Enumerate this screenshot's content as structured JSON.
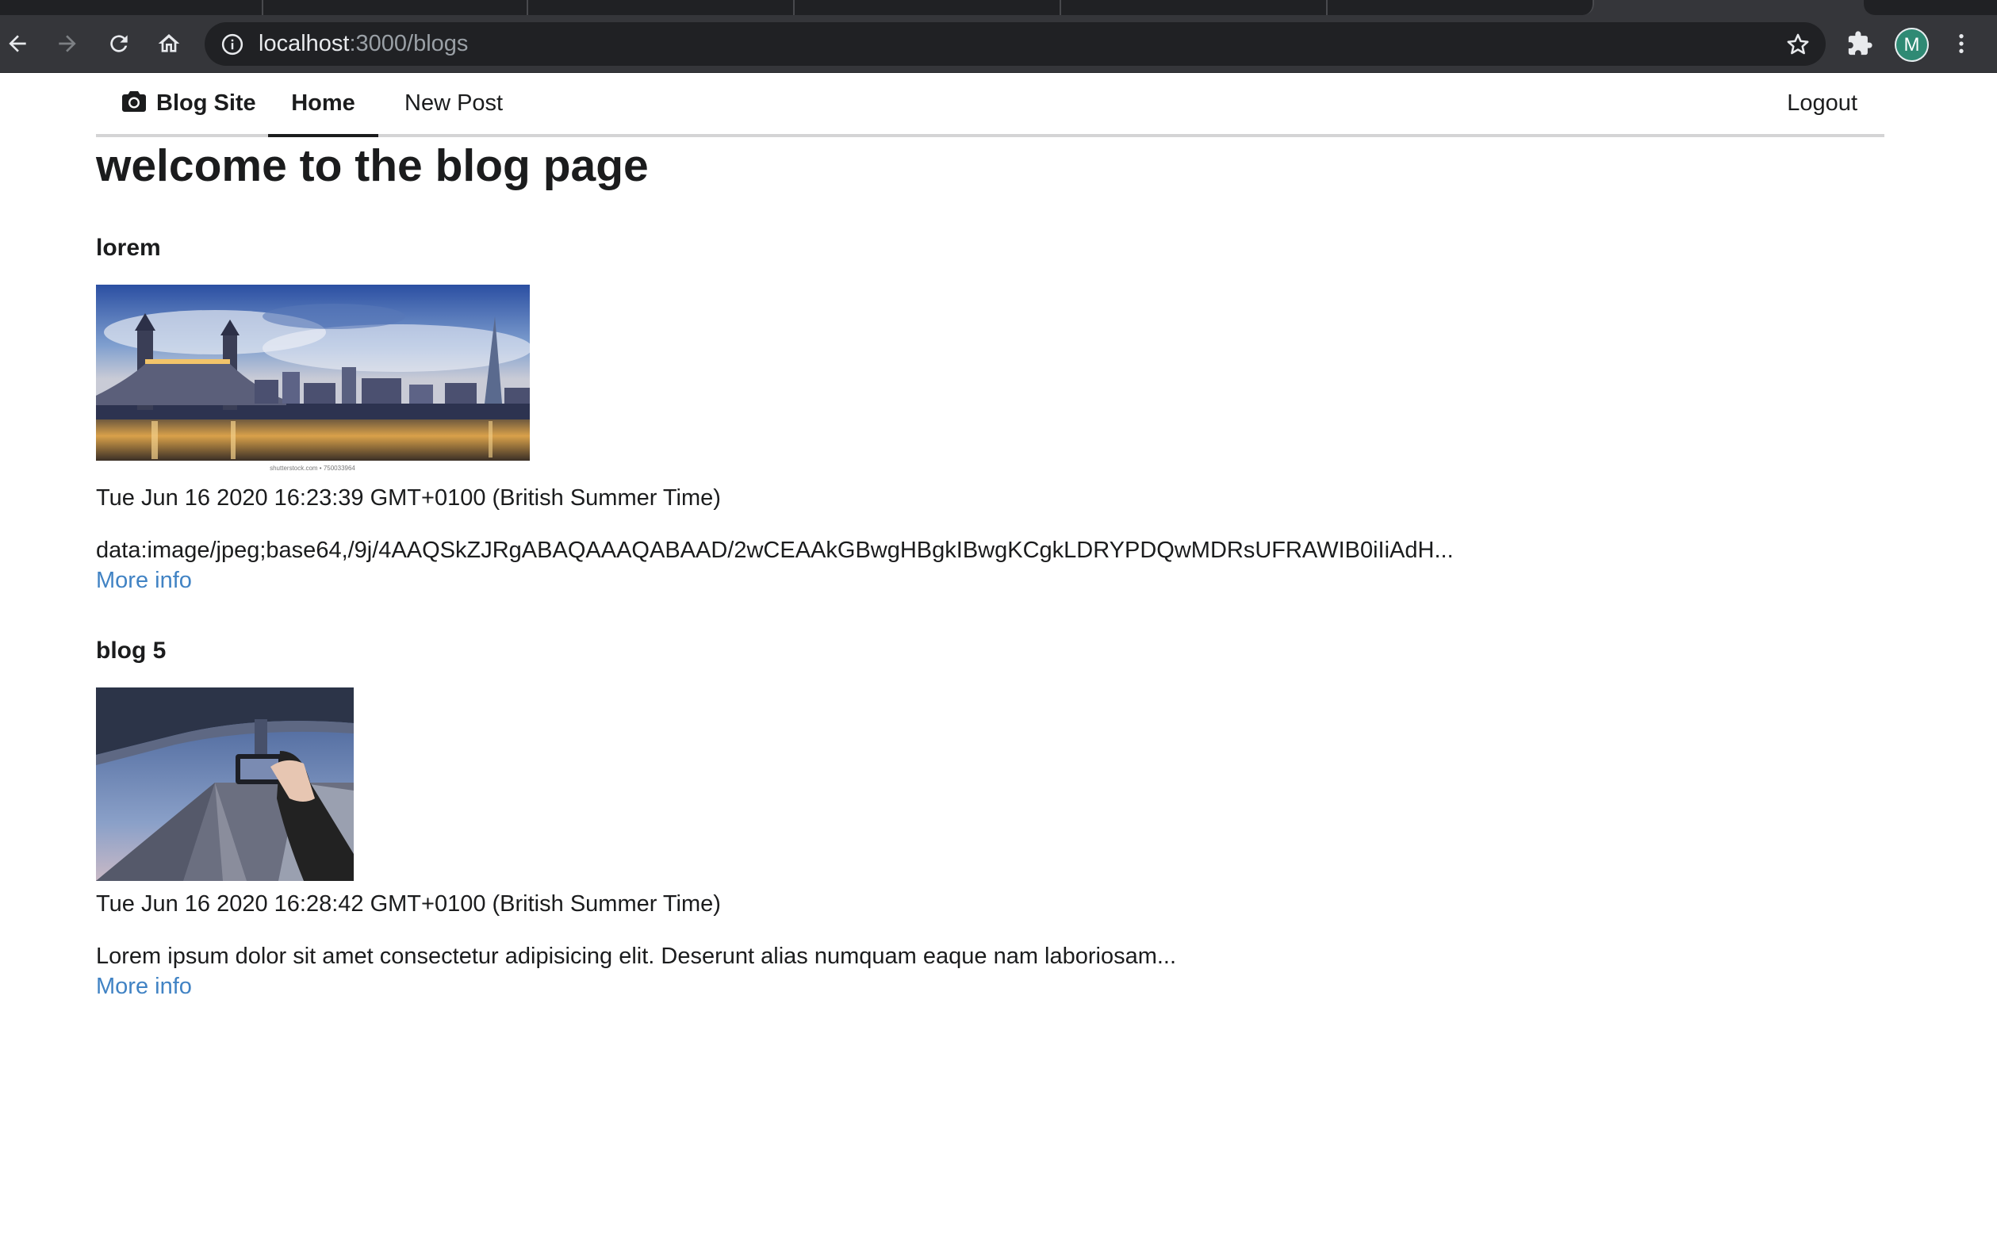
{
  "browser": {
    "url_host": "localhost",
    "url_path": ":3000/blogs",
    "profile_initial": "M"
  },
  "nav": {
    "brand": "Blog Site",
    "home": "Home",
    "new_post": "New Post",
    "logout": "Logout"
  },
  "page": {
    "title": "welcome to the blog page"
  },
  "posts": [
    {
      "title": "lorem",
      "date": "Tue Jun 16 2020 16:23:39 GMT+0100 (British Summer Time)",
      "excerpt": "data:image/jpeg;base64,/9j/4AAQSkZJRgABAQAAAQABAAD/2wCEAAkGBwgHBgkIBwgKCgkLDRYPDQwMDRsUFRAWIB0iIiAdH...",
      "more": "More info",
      "image_caption": "shutterstock.com • 750033964"
    },
    {
      "title": "blog 5",
      "date": "Tue Jun 16 2020 16:28:42 GMT+0100 (British Summer Time)",
      "excerpt": "Lorem ipsum dolor sit amet consectetur adipisicing elit. Deserunt alias numquam eaque nam laboriosam...",
      "more": "More info"
    }
  ],
  "colors": {
    "chrome_bg": "#35363a",
    "omnibox_bg": "#202124",
    "link": "#4183c4",
    "avatar": "#2f8a74"
  }
}
